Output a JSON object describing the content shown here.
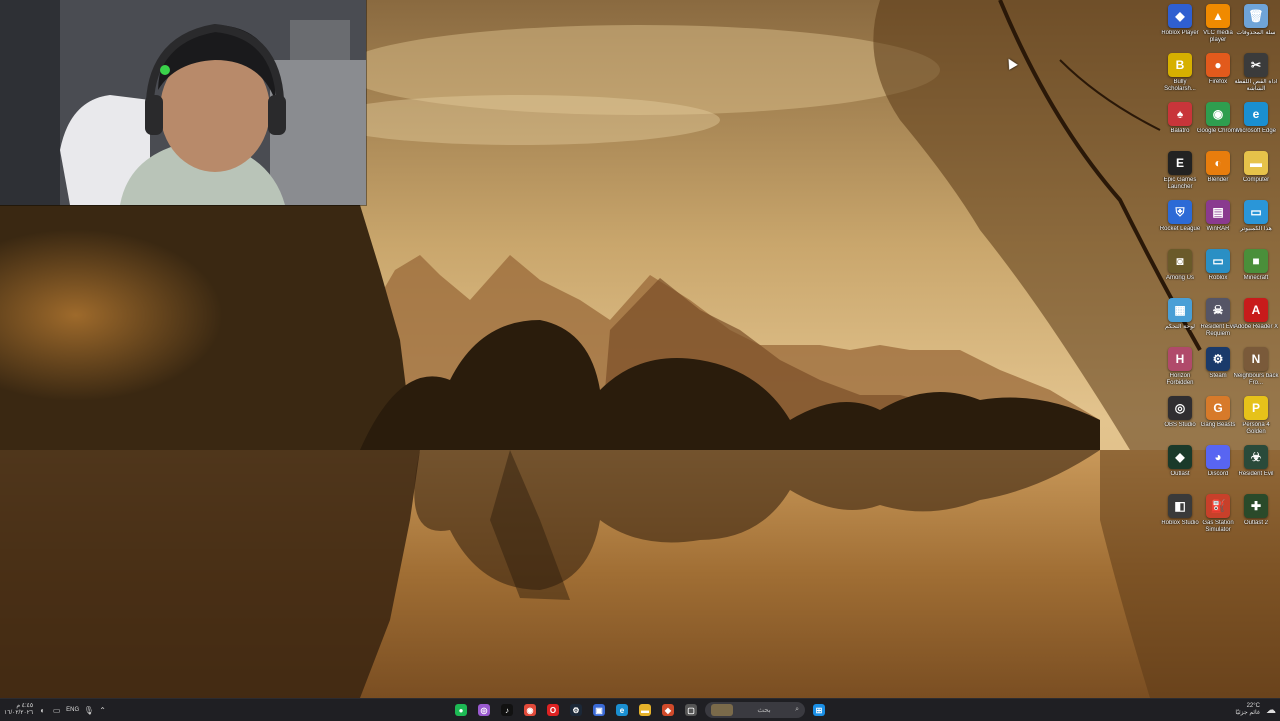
{
  "desktop": {
    "icons": [
      {
        "label": "Roblox Player",
        "icon": "roblox-icon",
        "color": "#2f5fd0",
        "glyph": "◆"
      },
      {
        "label": "VLC media player",
        "icon": "vlc-icon",
        "color": "#f08a00",
        "glyph": "▲"
      },
      {
        "label": "سلة المحذوفات",
        "icon": "recycle-bin-icon",
        "color": "#6fa4d8",
        "glyph": "🗑"
      },
      {
        "label": "Bully Scholarsh...",
        "icon": "bully-icon",
        "color": "#d6b000",
        "glyph": "B"
      },
      {
        "label": "Firefox",
        "icon": "firefox-icon",
        "color": "#e25a1c",
        "glyph": "●"
      },
      {
        "label": "أداة القص اللقطة الشاشة",
        "icon": "snipping-tool-icon",
        "color": "#3b3b3b",
        "glyph": "✂"
      },
      {
        "label": "Balatro",
        "icon": "balatro-icon",
        "color": "#c8353a",
        "glyph": "♠"
      },
      {
        "label": "Google Chrome",
        "icon": "chrome-icon",
        "color": "#2e9e4f",
        "glyph": "◉"
      },
      {
        "label": "Microsoft Edge",
        "icon": "edge-icon",
        "color": "#1a8fd1",
        "glyph": "e"
      },
      {
        "label": "Epic Games Launcher",
        "icon": "epic-games-icon",
        "color": "#222",
        "glyph": "E"
      },
      {
        "label": "Blender",
        "icon": "blender-icon",
        "color": "#e87d0d",
        "glyph": "◐"
      },
      {
        "label": "Computer",
        "icon": "folder-icon",
        "color": "#e6c24a",
        "glyph": "▬"
      },
      {
        "label": "Rocket League",
        "icon": "rocket-league-icon",
        "color": "#2c6ad6",
        "glyph": "⛨"
      },
      {
        "label": "WinRAR",
        "icon": "winrar-icon",
        "color": "#8a3a8f",
        "glyph": "▤"
      },
      {
        "label": "هذا الكمبيوتر",
        "icon": "this-pc-icon",
        "color": "#2a96d8",
        "glyph": "▭"
      },
      {
        "label": "Among Us",
        "icon": "among-us-icon",
        "color": "#6a5a2a",
        "glyph": "◙"
      },
      {
        "label": "Roblox",
        "icon": "network-icon",
        "color": "#2a8fc4",
        "glyph": "▭"
      },
      {
        "label": "Minecraft",
        "icon": "minecraft-icon",
        "color": "#4a8f3a",
        "glyph": "■"
      },
      {
        "label": "لوحة التحكم",
        "icon": "control-panel-icon",
        "color": "#4a9fd6",
        "glyph": "▦"
      },
      {
        "label": "Resident Evil Requiem",
        "icon": "resident-evil-requiem-icon",
        "color": "#556",
        "glyph": "☠"
      },
      {
        "label": "Adobe Reader X",
        "icon": "adobe-reader-icon",
        "color": "#c81b1b",
        "glyph": "A"
      },
      {
        "label": "Horizon Forbidden",
        "icon": "horizon-icon",
        "color": "#b04a6a",
        "glyph": "H"
      },
      {
        "label": "Steam",
        "icon": "steam-icon",
        "color": "#1a3a6a",
        "glyph": "⚙"
      },
      {
        "label": "Neighbours back Fro...",
        "icon": "neighbours-icon",
        "color": "#7a5a3a",
        "glyph": "N"
      },
      {
        "label": "OBS Studio",
        "icon": "obs-icon",
        "color": "#302e31",
        "glyph": "◎"
      },
      {
        "label": "Gang Beasts",
        "icon": "gang-beasts-icon",
        "color": "#d77a2a",
        "glyph": "G"
      },
      {
        "label": "Persona 4 Golden",
        "icon": "persona-icon",
        "color": "#e6c21a",
        "glyph": "P"
      },
      {
        "label": "Outlast",
        "icon": "outlast-icon",
        "color": "#1a3a2a",
        "glyph": "◆"
      },
      {
        "label": "Discord",
        "icon": "discord-icon",
        "color": "#5865f2",
        "glyph": "◕"
      },
      {
        "label": "Resident Evil",
        "icon": "resident-evil-icon",
        "color": "#2a4a3a",
        "glyph": "☣"
      },
      {
        "label": "Roblox Studio",
        "icon": "roblox-studio-icon",
        "color": "#3a3a3a",
        "glyph": "◧"
      },
      {
        "label": "Gas Station Simulator",
        "icon": "gas-station-icon",
        "color": "#c8402a",
        "glyph": "⛽"
      },
      {
        "label": "Outlast 2",
        "icon": "outlast-2-icon",
        "color": "#2a4a2a",
        "glyph": "✚"
      }
    ]
  },
  "taskbar": {
    "tray_lang": "ENG",
    "left_date": "١٦/٠٢/٢٠٢٦",
    "left_time": "٤:٤٥ م",
    "search_placeholder": "بحث",
    "weather_temp": "22°C",
    "weather_text": "غائم جزئيًا",
    "apps": [
      {
        "name": "spotify-icon",
        "color": "#1db954",
        "glyph": "●"
      },
      {
        "name": "app-icon",
        "color": "#9a5ad0",
        "glyph": "◎"
      },
      {
        "name": "tiktok-icon",
        "color": "#111",
        "glyph": "♪"
      },
      {
        "name": "chrome-icon",
        "color": "#e24a3a",
        "glyph": "◉"
      },
      {
        "name": "opera-icon",
        "color": "#d22",
        "glyph": "O"
      },
      {
        "name": "steam-icon",
        "color": "#1b2838",
        "glyph": "⚙"
      },
      {
        "name": "store-icon",
        "color": "#3a6ad6",
        "glyph": "▣"
      },
      {
        "name": "edge-icon",
        "color": "#1a8fd1",
        "glyph": "e"
      },
      {
        "name": "file-explorer-icon",
        "color": "#e6b22a",
        "glyph": "▬"
      },
      {
        "name": "office-icon",
        "color": "#d14a2a",
        "glyph": "◆"
      },
      {
        "name": "snipping-icon",
        "color": "#555",
        "glyph": "▢"
      }
    ]
  },
  "colors": {
    "sky_top": "#b8935a",
    "sky_mid": "#e2c38e",
    "water": "#a2723a",
    "taskbar": "#1f1f23",
    "start": "#1a8fe6"
  }
}
